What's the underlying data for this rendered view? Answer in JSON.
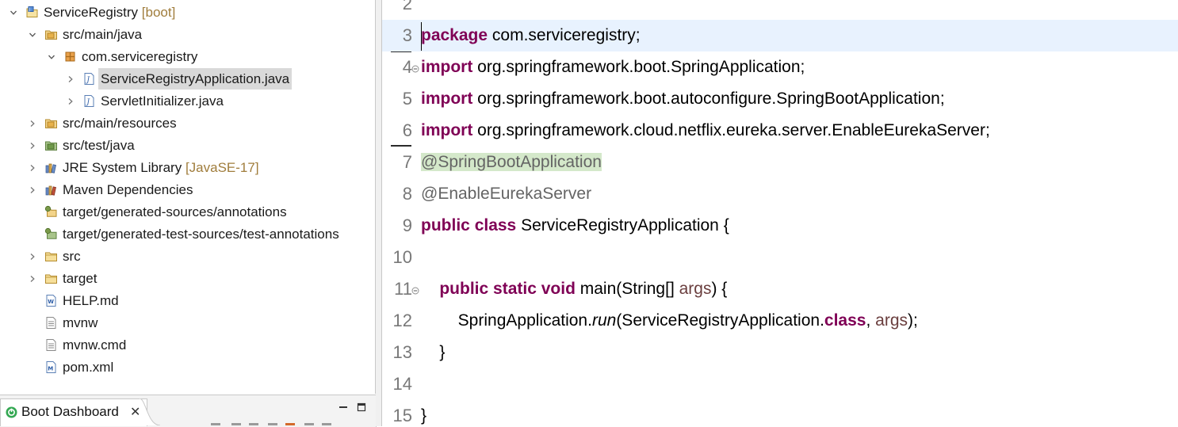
{
  "explorer": {
    "items": [
      {
        "label": "ServiceRegistry",
        "decoration": "[boot]",
        "icon": "boot-project-icon",
        "twisty": "expanded",
        "indent": 0
      },
      {
        "label": "src/main/java",
        "icon": "source-folder-icon",
        "twisty": "expanded",
        "indent": 1
      },
      {
        "label": "com.serviceregistry",
        "icon": "package-icon",
        "twisty": "expanded",
        "indent": 2
      },
      {
        "label": "ServiceRegistryApplication.java",
        "icon": "java-file-icon",
        "twisty": "collapsed",
        "indent": 3,
        "selected": true
      },
      {
        "label": "ServletInitializer.java",
        "icon": "java-file-icon",
        "twisty": "collapsed",
        "indent": 3
      },
      {
        "label": "src/main/resources",
        "icon": "source-folder-icon",
        "twisty": "collapsed",
        "indent": 1
      },
      {
        "label": "src/test/java",
        "icon": "test-source-folder-icon",
        "twisty": "collapsed",
        "indent": 1
      },
      {
        "label": "JRE System Library",
        "decoration": "[JavaSE-17]",
        "icon": "library-icon",
        "twisty": "collapsed",
        "indent": 1
      },
      {
        "label": "Maven Dependencies",
        "icon": "maven-library-icon",
        "twisty": "collapsed",
        "indent": 1
      },
      {
        "label": "target/generated-sources/annotations",
        "icon": "generated-source-folder-icon",
        "twisty": "none",
        "indent": 1
      },
      {
        "label": "target/generated-test-sources/test-annotations",
        "icon": "generated-test-folder-icon",
        "twisty": "none",
        "indent": 1
      },
      {
        "label": "src",
        "icon": "folder-icon",
        "twisty": "collapsed",
        "indent": 1
      },
      {
        "label": "target",
        "icon": "folder-icon",
        "twisty": "collapsed",
        "indent": 1
      },
      {
        "label": "HELP.md",
        "icon": "markdown-file-icon",
        "twisty": "none",
        "indent": 1
      },
      {
        "label": "mvnw",
        "icon": "text-file-icon",
        "twisty": "none",
        "indent": 1
      },
      {
        "label": "mvnw.cmd",
        "icon": "text-file-icon",
        "twisty": "none",
        "indent": 1
      },
      {
        "label": "pom.xml",
        "icon": "maven-pom-icon",
        "twisty": "none",
        "indent": 1
      }
    ]
  },
  "boot_dashboard": {
    "title": "Boot Dashboard",
    "close_glyph": "✕",
    "icon": "spring-boot-icon"
  },
  "editor": {
    "current_line": 3,
    "lines": [
      {
        "num": "2",
        "tokens": []
      },
      {
        "num": "3",
        "tokens": [
          {
            "t": "package",
            "c": "kw"
          },
          {
            "t": " com.serviceregistry;"
          }
        ]
      },
      {
        "num": "4",
        "fold": true,
        "tokens": [
          {
            "t": "import",
            "c": "kw"
          },
          {
            "t": " org.springframework.boot.SpringApplication;"
          }
        ]
      },
      {
        "num": "5",
        "tokens": [
          {
            "t": "import",
            "c": "kw"
          },
          {
            "t": " org.springframework.boot.autoconfigure.SpringBootApplication;"
          }
        ]
      },
      {
        "num": "6",
        "tokens": [
          {
            "t": "import",
            "c": "kw"
          },
          {
            "t": " org.springframework.cloud.netflix.eureka.server.EnableEurekaServer;"
          }
        ]
      },
      {
        "num": "7",
        "tokens": [
          {
            "t": "@SpringBootApplication",
            "c": "ann ann-hl"
          }
        ]
      },
      {
        "num": "8",
        "tokens": [
          {
            "t": "@EnableEurekaServer",
            "c": "ann"
          }
        ]
      },
      {
        "num": "9",
        "tokens": [
          {
            "t": "public",
            "c": "kw"
          },
          {
            "t": " "
          },
          {
            "t": "class",
            "c": "kw"
          },
          {
            "t": " ServiceRegistryApplication {"
          }
        ]
      },
      {
        "num": "10",
        "tokens": []
      },
      {
        "num": "11",
        "fold": true,
        "tokens": [
          {
            "t": "    "
          },
          {
            "t": "public",
            "c": "kw"
          },
          {
            "t": " "
          },
          {
            "t": "static",
            "c": "kw"
          },
          {
            "t": " "
          },
          {
            "t": "void",
            "c": "kw"
          },
          {
            "t": " main(String[] "
          },
          {
            "t": "args",
            "c": "param"
          },
          {
            "t": ") {"
          }
        ]
      },
      {
        "num": "12",
        "tokens": [
          {
            "t": "        SpringApplication."
          },
          {
            "t": "run",
            "c": "static-m"
          },
          {
            "t": "(ServiceRegistryApplication."
          },
          {
            "t": "class",
            "c": "kw"
          },
          {
            "t": ", "
          },
          {
            "t": "args",
            "c": "param"
          },
          {
            "t": ");"
          }
        ]
      },
      {
        "num": "13",
        "tokens": [
          {
            "t": "    }"
          }
        ]
      },
      {
        "num": "14",
        "tokens": []
      },
      {
        "num": "15",
        "tokens": [
          {
            "t": "}"
          }
        ]
      }
    ]
  }
}
